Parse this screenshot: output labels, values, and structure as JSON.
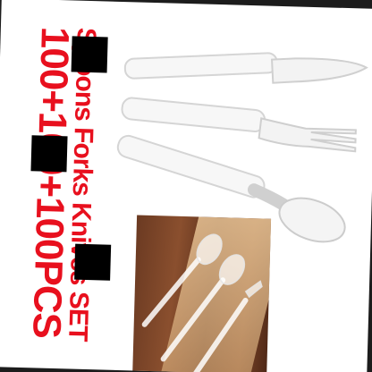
{
  "promo": {
    "count_text": "100+100+100PCS",
    "title_text": "Spoons Forks Knives SET"
  },
  "colors": {
    "promo_red": "#e8101e",
    "utensil_white": "#f6f6f6",
    "utensil_shadow": "#d7d7d7",
    "wood": "#6b3a22",
    "redaction": "#000000"
  },
  "items": [
    {
      "name": "knife",
      "icon": "knife-icon"
    },
    {
      "name": "fork",
      "icon": "fork-icon"
    },
    {
      "name": "spoon",
      "icon": "spoon-icon"
    }
  ]
}
